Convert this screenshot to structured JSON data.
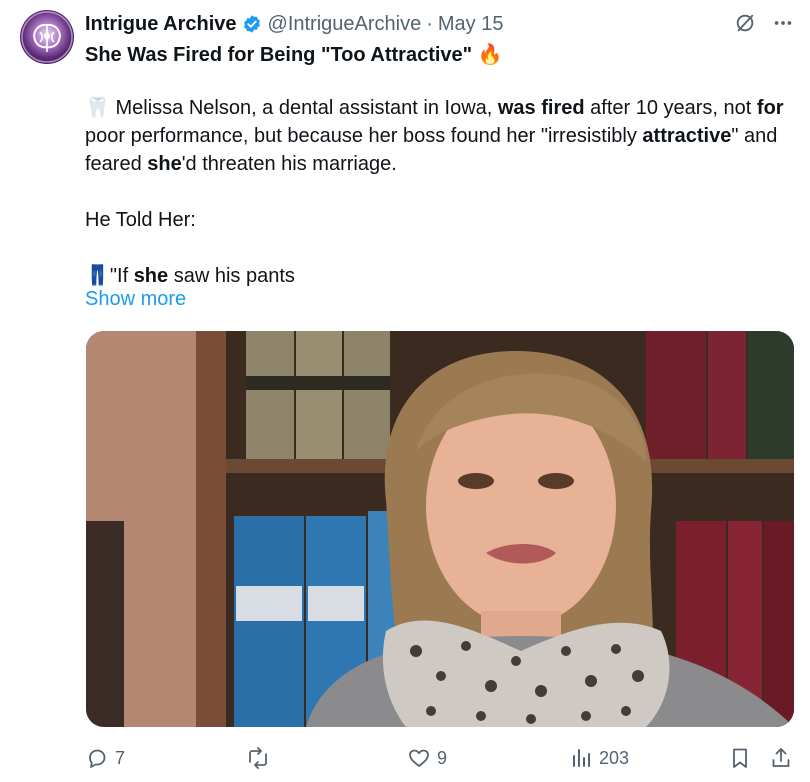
{
  "tweet": {
    "author_name": "Intrigue Archive",
    "handle": "@IntrigueArchive",
    "separator": "·",
    "date": "May 15",
    "title": "She Was Fired for Being \"Too Attractive\"",
    "title_emoji": "🔥",
    "paragraph1": {
      "emoji": "🦷",
      "t1": " Melissa Nelson, a dental assistant in Iowa, ",
      "b1": "was fired",
      "t2": " after 10 years, not ",
      "b2": "for",
      "t3": " poor performance, but because her boss found her \"irresistibly ",
      "b3": "attractive",
      "t4": "\" and feared ",
      "b4": "she",
      "t5": "'d threaten his marriage."
    },
    "paragraph2": "He Told Her:",
    "paragraph3": {
      "emoji": "👖",
      "t1": "\"If ",
      "b1": "she",
      "t2": " saw his pants"
    },
    "show_more": "Show more"
  },
  "actions": {
    "reply_count": "7",
    "repost_count": "",
    "like_count": "9",
    "view_count": "203"
  },
  "colors": {
    "link": "#1d9bf0",
    "verified": "#1d9bf0",
    "muted": "#536471"
  }
}
